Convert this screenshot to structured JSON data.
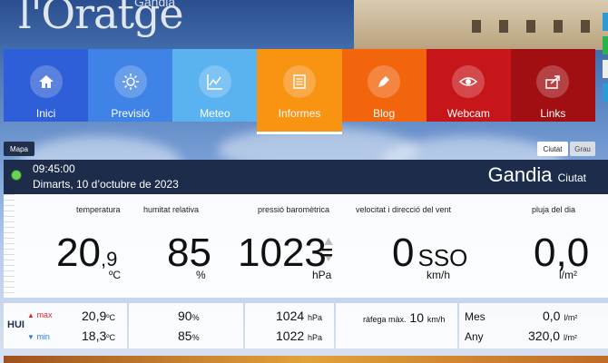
{
  "header": {
    "logo": "l'Oratge",
    "logo_sub": "Gandia"
  },
  "nav": {
    "items": [
      {
        "label": "Inici",
        "color": "#2f5fd8",
        "icon": "home-icon"
      },
      {
        "label": "Previsió",
        "color": "#3f83e6",
        "icon": "sun-icon"
      },
      {
        "label": "Meteo",
        "color": "#5ab3f0",
        "icon": "chart-line-icon"
      },
      {
        "label": "Informes",
        "color": "#f99312",
        "icon": "document-icon",
        "active": true
      },
      {
        "label": "Blog",
        "color": "#f3650c",
        "icon": "pen-icon"
      },
      {
        "label": "Webcam",
        "color": "#c7161a",
        "icon": "eye-icon"
      },
      {
        "label": "Links",
        "color": "#a10f12",
        "icon": "share-icon"
      }
    ]
  },
  "buttons": {
    "mapa": "Mapa",
    "ciutat": "Ciutat",
    "grau": "Grau"
  },
  "station": {
    "time": "09:45:00",
    "date": "Dimarts, 10 d’octubre de 2023",
    "city": "Gandia",
    "city_sub": "Ciutat"
  },
  "metrics": {
    "temperature": {
      "label": "temperatura",
      "int": "20",
      "dec": ",9",
      "unit": "ºC"
    },
    "humidity": {
      "label": "humitat relativa",
      "value": "85",
      "unit": "%"
    },
    "pressure": {
      "label": "pressió baromètrica",
      "value": "1023",
      "trend": "=",
      "unit": "hPa"
    },
    "wind": {
      "label": "velocitat i direcció del vent",
      "value": "0",
      "dir": "SSO",
      "unit": "km/h"
    },
    "rain": {
      "label": "pluja del dia",
      "value": "0,0",
      "unit": "l/m²"
    }
  },
  "today": {
    "label": "HUI",
    "max_label": "max",
    "min_label": "min",
    "temp_max": "20,9",
    "temp_min": "18,3",
    "temp_unit": "ºC",
    "hum_max": "90",
    "hum_min": "85",
    "hum_unit": "%",
    "press_max": "1024",
    "press_min": "1022",
    "press_unit": "hPa",
    "gust_label": "ràfega màx.",
    "gust_value": "10",
    "gust_unit": "km/h",
    "rain_month_label": "Mes",
    "rain_month": "0,0",
    "rain_year_label": "Any",
    "rain_year": "320,0",
    "rain_unit": "l/m²"
  }
}
